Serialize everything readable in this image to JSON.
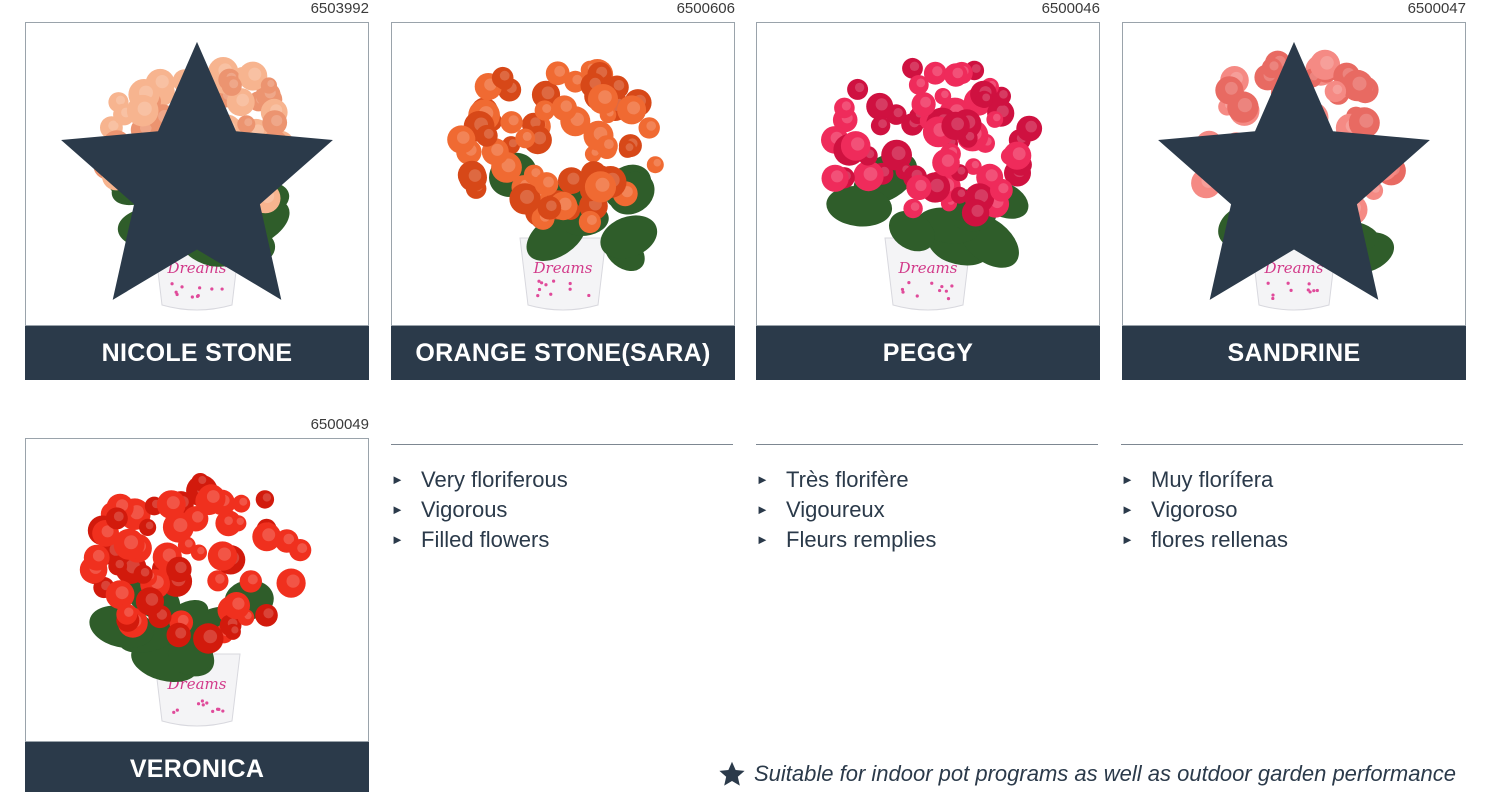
{
  "cards": [
    {
      "code": "6503992",
      "name": "NICOLE STONE",
      "flower_color": "#f7b48f",
      "flower_dark": "#ec9470",
      "starred": true
    },
    {
      "code": "6500606",
      "name": "ORANGE STONE(SARA)",
      "flower_color": "#f06a32",
      "flower_dark": "#d74818",
      "starred": false
    },
    {
      "code": "6500046",
      "name": "PEGGY",
      "flower_color": "#ef2b5b",
      "flower_dark": "#cf1140",
      "starred": false
    },
    {
      "code": "6500047",
      "name": "SANDRINE",
      "flower_color": "#f58a84",
      "flower_dark": "#e86a62",
      "starred": true
    },
    {
      "code": "6500049",
      "name": "VERONICA",
      "flower_color": "#f0301e",
      "flower_dark": "#d21a0c",
      "starred": false
    }
  ],
  "pot_label": "Dreams",
  "features": {
    "english": [
      "Very floriferous",
      "Vigorous",
      "Filled flowers"
    ],
    "french": [
      "Très florifère",
      "Vigoureux",
      "Fleurs remplies"
    ],
    "spanish": [
      "Muy florífera",
      "Vigoroso",
      "flores rellenas"
    ]
  },
  "footnote": "Suitable for indoor pot programs as well as outdoor garden performance",
  "colors": {
    "navy": "#2b3a4a",
    "leaf": "#2f5d2a"
  }
}
